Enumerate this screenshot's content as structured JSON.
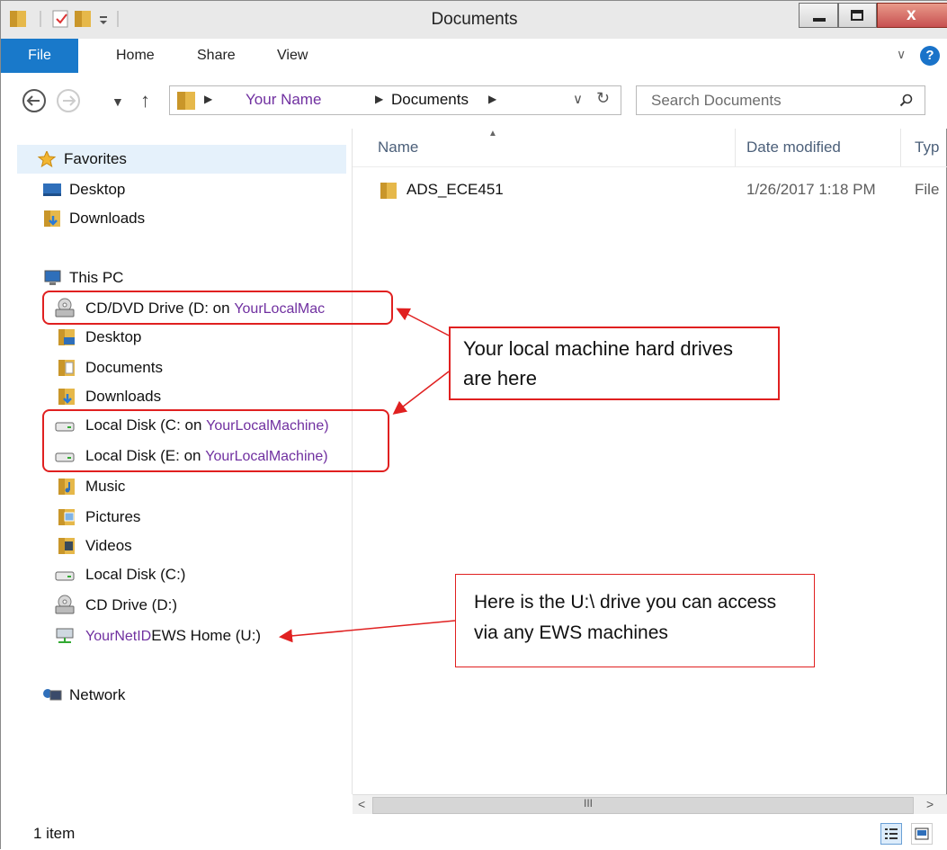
{
  "window": {
    "title": "Documents"
  },
  "window_controls": {
    "minimize": "–",
    "maximize": "▢",
    "close": "x"
  },
  "ribbon": {
    "tabs": [
      "File",
      "Home",
      "Share",
      "View"
    ],
    "help": "?"
  },
  "address": {
    "segment_user": "Your Name",
    "segment_docs": "Documents",
    "search_placeholder": "Search Documents"
  },
  "nav_pane": {
    "favorites_header": "Favorites",
    "favorites": [
      "Desktop",
      "Downloads"
    ],
    "thispc_header": "This PC",
    "cd_dvd": {
      "label": "CD/DVD Drive (D: on ",
      "machine": "YourLocalMac"
    },
    "pc_folders": [
      "Desktop",
      "Documents",
      "Downloads"
    ],
    "local_c": {
      "label": "Local Disk (C: on ",
      "machine": "YourLocalMachine)"
    },
    "local_e": {
      "label": "Local Disk (E: on ",
      "machine": "YourLocalMachine)"
    },
    "media": [
      "Music",
      "Pictures",
      "Videos"
    ],
    "local_disk": "Local Disk (C:)",
    "cd_drive": "CD Drive (D:)",
    "u_drive": {
      "netid": "YourNetID",
      "label": "EWS Home (U:)"
    },
    "network": "Network"
  },
  "content": {
    "columns": [
      "Name",
      "Date modified",
      "Typ"
    ],
    "rows": [
      {
        "name": "ADS_ECE451",
        "date": "1/26/2017 1:18 PM",
        "type": "File"
      }
    ]
  },
  "status": {
    "count": "1 item"
  },
  "annotations": {
    "callout_1": "Your local machine hard drives are here",
    "callout_2": "Here is the U:\\ drive you can access via any EWS machines"
  },
  "colors": {
    "accent": "#1979ca",
    "annotation": "#e02020",
    "highlight_text": "#7030a0"
  }
}
